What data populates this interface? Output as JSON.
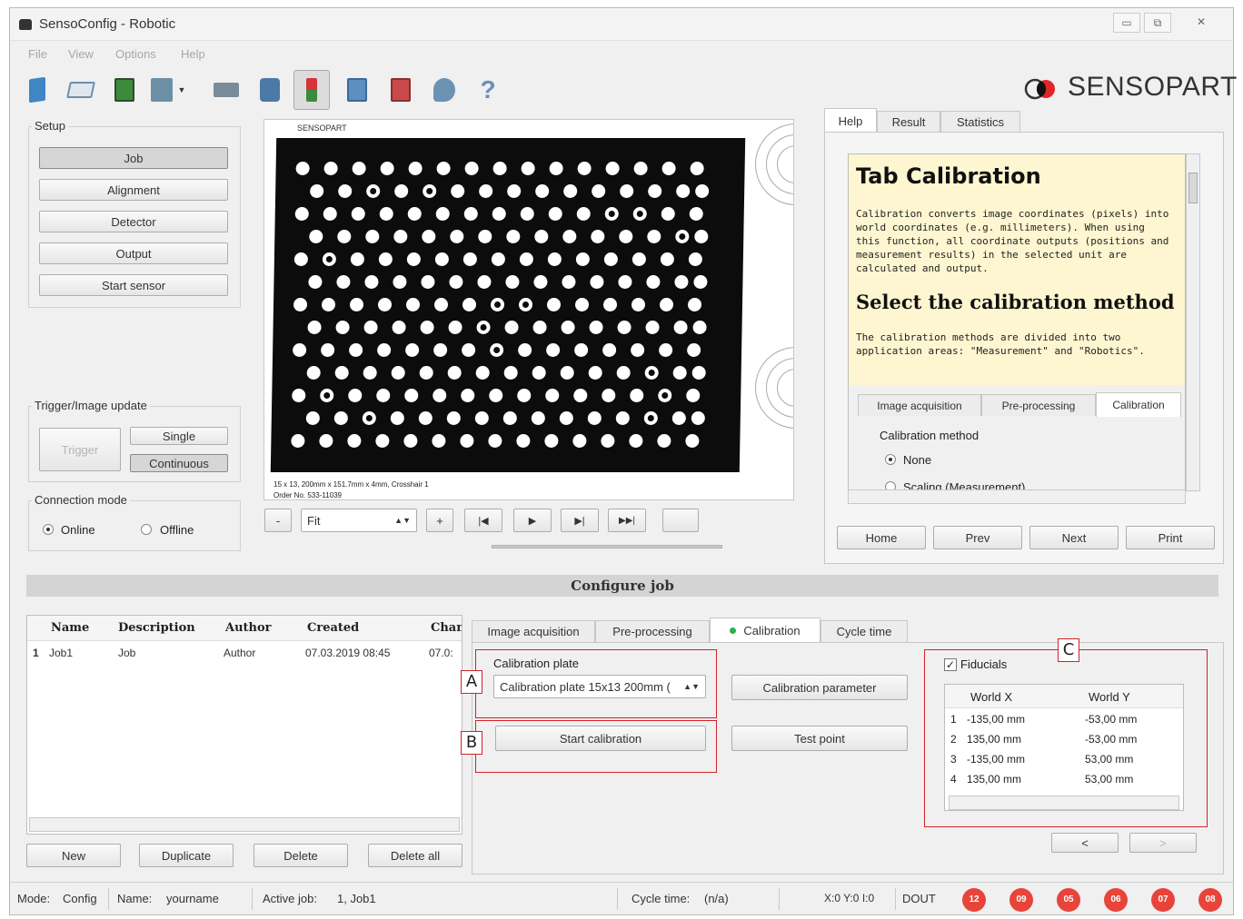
{
  "window": {
    "title": "SensoConfig - Robotic",
    "minimize": "▭",
    "restore": "⧉",
    "close": "✕"
  },
  "menu": [
    "File",
    "View",
    "Options",
    "Help"
  ],
  "brand": {
    "text": "SENSOPART"
  },
  "toolbar": {
    "icons": [
      "new-job-icon",
      "open-icon",
      "save-icon",
      "export-icon",
      "import-icon",
      "sensor-icon",
      "config-icon",
      "run-icon",
      "compare-icon",
      "archive-icon",
      "search-icon",
      "help-icon"
    ],
    "colors": [
      "#3f86c4",
      "#6a8fae",
      "#3c8a3c",
      "#6d8fa6",
      "#7a8b99",
      "#4d79a8",
      "#d8323a",
      "#5d8fc0",
      "#c84a4a",
      "#6c92b3",
      "#6a90b8"
    ]
  },
  "setup": {
    "title": "Setup",
    "buttons": [
      "Job",
      "Alignment",
      "Detector",
      "Output",
      "Start sensor"
    ]
  },
  "trigger": {
    "title": "Trigger/Image update",
    "trigger": "Trigger",
    "single": "Single",
    "continuous": "Continuous"
  },
  "connection": {
    "title": "Connection mode",
    "online": "Online",
    "offline": "Offline"
  },
  "image": {
    "brand": "SENSOPART",
    "caption1": "15 x 13, 200mm x 151.7mm x 4mm, Crosshair 1",
    "caption2": "Order No. 533-11039"
  },
  "player": {
    "minus": "-",
    "zoom": "Fit",
    "plus": "+",
    "first": "|◀",
    "play": "▶",
    "step": "▶|",
    "last": "▶▶|"
  },
  "help": {
    "tabs": [
      "Help",
      "Result",
      "Statistics"
    ],
    "h1": "Tab Calibration",
    "p1": "Calibration converts image coordinates (pixels) into world coordinates (e.g. millimeters). When using this function, all coordinate outputs (positions and measurement results) in the selected unit are calculated and output.",
    "h2": "Select the calibration method",
    "p2": "The calibration methods are divided into two application areas: \"Measurement\" and \"Robotics\".",
    "inner_tabs": [
      "Image acquisition",
      "Pre-processing",
      "Calibration"
    ],
    "method_label": "Calibration method",
    "opt_none": "None",
    "opt_scaling": "Scaling (Measurement)",
    "nav": [
      "Home",
      "Prev",
      "Next",
      "Print"
    ]
  },
  "configure": {
    "title": "Configure job"
  },
  "jobs": {
    "headers": [
      "Name",
      "Description",
      "Author",
      "Created",
      "Chan"
    ],
    "row": {
      "index": "1",
      "name": "Job1",
      "description": "Job",
      "author": "Author",
      "created": "07.03.2019 08:45",
      "changed": "07.0:"
    },
    "buttons": [
      "New",
      "Duplicate",
      "Delete",
      "Delete all"
    ]
  },
  "config_tabs": [
    "Image acquisition",
    "Pre-processing",
    "Calibration",
    "Cycle time"
  ],
  "calibration": {
    "plate_label": "Calibration plate",
    "plate_value": "Calibration plate 15x13 200mm (",
    "param_button": "Calibration parameter",
    "start_button": "Start calibration",
    "test_button": "Test point",
    "fiducials_label": "Fiducials",
    "fid_headers": [
      "World X",
      "World Y"
    ],
    "fid_rows": [
      {
        "i": "1",
        "x": "-135,00 mm",
        "y": "-53,00 mm"
      },
      {
        "i": "2",
        "x": "135,00 mm",
        "y": "-53,00 mm"
      },
      {
        "i": "3",
        "x": "-135,00 mm",
        "y": "53,00 mm"
      },
      {
        "i": "4",
        "x": "135,00 mm",
        "y": "53,00 mm"
      }
    ],
    "prev": "<",
    "next": ">"
  },
  "callouts": [
    "A",
    "B",
    "C"
  ],
  "status": {
    "mode_label": "Mode:",
    "mode": "Config",
    "name_label": "Name:",
    "name": "yourname",
    "active_label": "Active job:",
    "active": "1, Job1",
    "cycle_label": "Cycle time:",
    "cycle": "(n/a)",
    "xy": "X:0 Y:0 I:0",
    "dout": "DOUT",
    "leds": [
      "12",
      "09",
      "05",
      "06",
      "07",
      "08"
    ]
  }
}
